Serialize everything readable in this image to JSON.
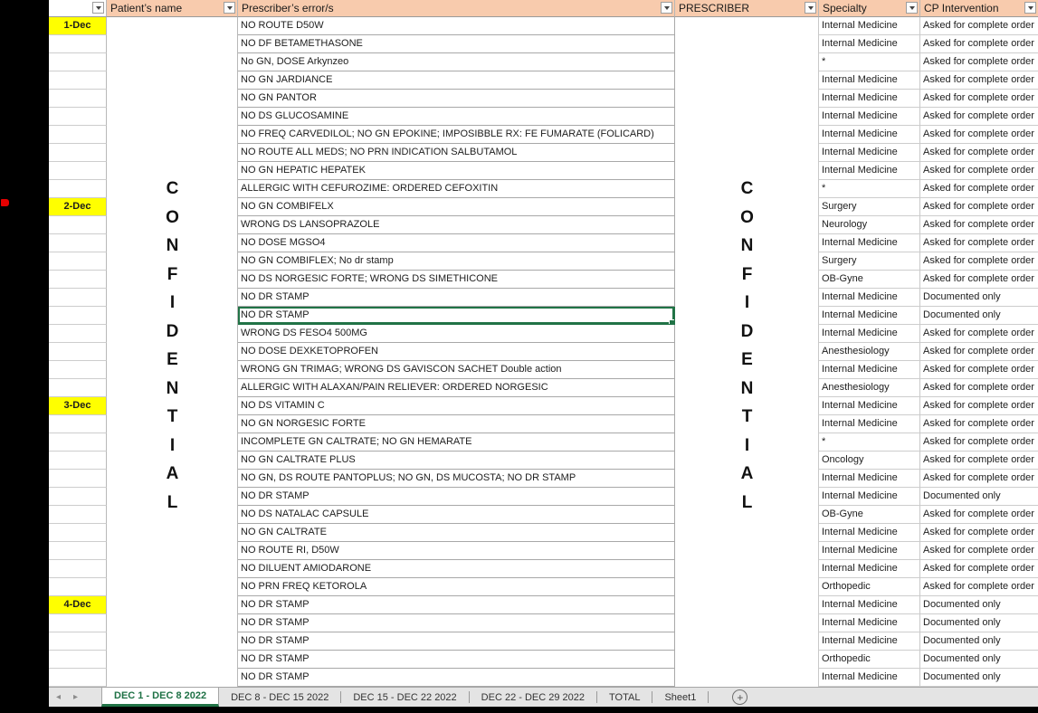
{
  "header": {
    "columns": {
      "date": "",
      "patient": "Patient’s name",
      "error": "Prescriber’s error/s",
      "prescriber": "PRESCRIBER",
      "specialty": "Specialty",
      "intervention": "CP Intervention"
    }
  },
  "watermark": "CONFIDENTIAL",
  "colors": {
    "header_fill": "#F8CBAD",
    "date_highlight": "#FFFF00",
    "selection_green": "#217346",
    "active_tab_green": "#1E7145"
  },
  "rows": [
    {
      "date": "1-Dec",
      "error": "NO ROUTE D50W",
      "specialty": "Internal Medicine",
      "intervention": "Asked for complete order"
    },
    {
      "date": "",
      "error": "NO DF BETAMETHASONE",
      "specialty": "Internal Medicine",
      "intervention": "Asked for complete order"
    },
    {
      "date": "",
      "error": "No GN, DOSE Arkynzeo",
      "specialty": "*",
      "intervention": "Asked for complete order"
    },
    {
      "date": "",
      "error": "NO GN JARDIANCE",
      "specialty": "Internal Medicine",
      "intervention": "Asked for complete order"
    },
    {
      "date": "",
      "error": "NO GN PANTOR",
      "specialty": "Internal Medicine",
      "intervention": "Asked for complete order"
    },
    {
      "date": "",
      "error": "NO DS GLUCOSAMINE",
      "specialty": "Internal Medicine",
      "intervention": "Asked for complete order"
    },
    {
      "date": "",
      "error": "NO FREQ CARVEDILOL; NO GN EPOKINE; IMPOSIBBLE RX: FE FUMARATE (FOLICARD)",
      "specialty": "Internal Medicine",
      "intervention": "Asked for complete order"
    },
    {
      "date": "",
      "error": "NO ROUTE ALL MEDS; NO PRN INDICATION SALBUTAMOL",
      "specialty": "Internal Medicine",
      "intervention": "Asked for complete order"
    },
    {
      "date": "",
      "error": "NO GN HEPATIC HEPATEK",
      "specialty": "Internal Medicine",
      "intervention": "Asked for complete order"
    },
    {
      "date": "",
      "error": "ALLERGIC WITH CEFUROZIME: ORDERED CEFOXITIN",
      "specialty": "*",
      "intervention": "Asked for complete order"
    },
    {
      "date": "2-Dec",
      "error": "NO GN COMBIFELX",
      "specialty": "Surgery",
      "intervention": "Asked for complete order"
    },
    {
      "date": "",
      "error": "WRONG DS LANSOPRAZOLE",
      "specialty": "Neurology",
      "intervention": "Asked for complete order"
    },
    {
      "date": "",
      "error": "NO DOSE MGSO4",
      "specialty": "Internal Medicine",
      "intervention": "Asked for complete order"
    },
    {
      "date": "",
      "error": "NO GN COMBIFLEX; No dr stamp",
      "specialty": "Surgery",
      "intervention": "Asked for complete order"
    },
    {
      "date": "",
      "error": "NO DS NORGESIC FORTE; WRONG DS SIMETHICONE",
      "specialty": "OB-Gyne",
      "intervention": "Asked for complete order"
    },
    {
      "date": "",
      "error": "NO DR STAMP",
      "specialty": "Internal Medicine",
      "intervention": "Documented only"
    },
    {
      "date": "",
      "error": "NO DR STAMP",
      "specialty": "Internal Medicine",
      "intervention": "Documented only",
      "selected": true
    },
    {
      "date": "",
      "error": "WRONG DS FESO4 500MG",
      "specialty": "Internal Medicine",
      "intervention": "Asked for complete order"
    },
    {
      "date": "",
      "error": "NO DOSE DEXKETOPROFEN",
      "specialty": "Anesthesiology",
      "intervention": "Asked for complete order"
    },
    {
      "date": "",
      "error": "WRONG GN TRIMAG;  WRONG DS GAVISCON SACHET Double action",
      "specialty": "Internal Medicine",
      "intervention": "Asked for complete order"
    },
    {
      "date": "",
      "error": "ALLERGIC WITH ALAXAN/PAIN RELIEVER: ORDERED NORGESIC",
      "specialty": "Anesthesiology",
      "intervention": "Asked for complete order"
    },
    {
      "date": "3-Dec",
      "error": "NO DS VITAMIN C",
      "specialty": "Internal Medicine",
      "intervention": "Asked for complete order"
    },
    {
      "date": "",
      "error": "NO GN NORGESIC FORTE",
      "specialty": "Internal Medicine",
      "intervention": "Asked for complete order"
    },
    {
      "date": "",
      "error": "INCOMPLETE GN CALTRATE; NO GN HEMARATE",
      "specialty": "*",
      "intervention": "Asked for complete order"
    },
    {
      "date": "",
      "error": "NO GN CALTRATE PLUS",
      "specialty": "Oncology",
      "intervention": "Asked for complete order"
    },
    {
      "date": "",
      "error": "NO GN, DS ROUTE PANTOPLUS; NO GN, DS MUCOSTA; NO DR STAMP",
      "specialty": "Internal Medicine",
      "intervention": "Asked for complete order"
    },
    {
      "date": "",
      "error": "NO DR STAMP",
      "specialty": "Internal Medicine",
      "intervention": "Documented only"
    },
    {
      "date": "",
      "error": "NO DS NATALAC CAPSULE",
      "specialty": "OB-Gyne",
      "intervention": "Asked for complete order"
    },
    {
      "date": "",
      "error": "NO GN CALTRATE",
      "specialty": "Internal Medicine",
      "intervention": "Asked for complete order"
    },
    {
      "date": "",
      "error": "NO ROUTE RI, D50W",
      "specialty": "Internal Medicine",
      "intervention": "Asked for complete order"
    },
    {
      "date": "",
      "error": "NO DILUENT AMIODARONE",
      "specialty": "Internal Medicine",
      "intervention": "Asked for complete order"
    },
    {
      "date": "",
      "error": "NO PRN FREQ KETOROLA",
      "specialty": "Orthopedic",
      "intervention": "Asked for complete order"
    },
    {
      "date": "4-Dec",
      "error": "NO DR STAMP",
      "specialty": "Internal Medicine",
      "intervention": "Documented only"
    },
    {
      "date": "",
      "error": "NO DR STAMP",
      "specialty": "Internal Medicine",
      "intervention": "Documented only"
    },
    {
      "date": "",
      "error": "NO DR STAMP",
      "specialty": "Internal Medicine",
      "intervention": "Documented only"
    },
    {
      "date": "",
      "error": "NO DR STAMP",
      "specialty": "Orthopedic",
      "intervention": "Documented only"
    },
    {
      "date": "",
      "error": "NO DR STAMP",
      "specialty": "Internal Medicine",
      "intervention": "Documented only"
    }
  ],
  "sheet_tabs": {
    "tabs": [
      {
        "label": "DEC 1 - DEC 8 2022",
        "active": true
      },
      {
        "label": "DEC 8 - DEC 15 2022",
        "active": false
      },
      {
        "label": "DEC 15 - DEC 22 2022",
        "active": false
      },
      {
        "label": "DEC 22 - DEC 29 2022",
        "active": false
      },
      {
        "label": "TOTAL",
        "active": false
      },
      {
        "label": "Sheet1",
        "active": false
      }
    ],
    "nav_prev": "◂",
    "nav_next": "▸",
    "add_label": "+"
  }
}
